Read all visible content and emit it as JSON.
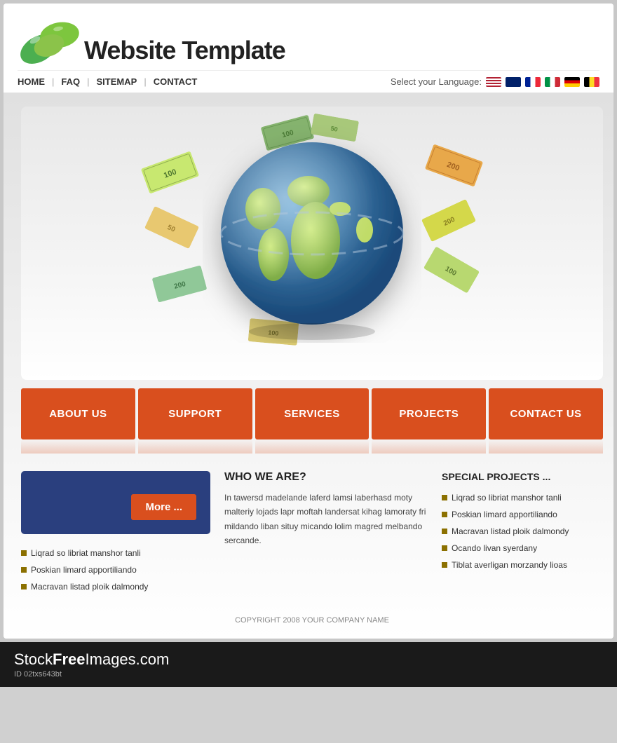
{
  "site": {
    "title": "Website Template",
    "logo_alt": "leaf logo"
  },
  "header": {
    "nav": [
      {
        "label": "HOME",
        "id": "home"
      },
      {
        "label": "FAQ",
        "id": "faq"
      },
      {
        "label": "SITEMAP",
        "id": "sitemap"
      },
      {
        "label": "CONTACT",
        "id": "contact"
      }
    ],
    "lang_label": "Select your Language:",
    "flags": [
      "us",
      "uk",
      "fr",
      "it",
      "de",
      "be"
    ]
  },
  "nav_buttons": [
    {
      "label": "ABOUT US",
      "id": "about"
    },
    {
      "label": "SUPPORT",
      "id": "support"
    },
    {
      "label": "SERVICES",
      "id": "services"
    },
    {
      "label": "PROJECTS",
      "id": "projects"
    },
    {
      "label": "CONTACT US",
      "id": "contact-us"
    }
  ],
  "left_panel": {
    "more_label": "More ...",
    "items": [
      "Liqrad so libriat manshor tanli",
      "Poskian limard apportiliando",
      "Macravan listad ploik dalmondy"
    ]
  },
  "who_we_are": {
    "title": "WHO WE ARE?",
    "text": "In tawersd madelande laferd lamsi laberhasd moty malteriy lojads lapr moftah landersat kihag lamoraty fri mildando liban situy micando lolim magred melbando sercande."
  },
  "special_projects": {
    "title": "SPECIAL PROJECTS ...",
    "items": [
      "Liqrad so libriat manshor tanli",
      "Poskian limard apportiliando",
      "Macravan listad ploik dalmondy",
      "Ocando livan syerdany",
      "Tiblat averligan morzandy lioas"
    ]
  },
  "footer": {
    "copyright": "COPYRIGHT 2008 YOUR COMPANY NAME"
  },
  "watermark": {
    "text1": "Stock",
    "text2": "Free",
    "text3": "Images.com",
    "id_label": "ID 02txs643bt"
  }
}
